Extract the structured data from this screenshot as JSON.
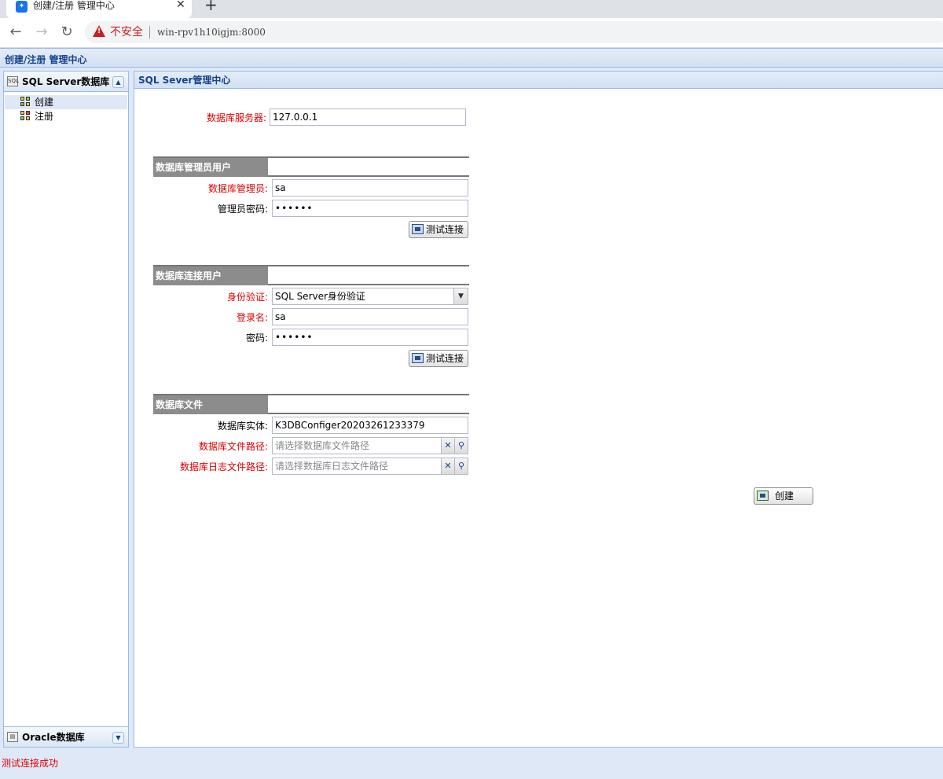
{
  "browser": {
    "tab_title": "创建/注册 管理中心",
    "insecure_label": "不安全",
    "url": "win-rpv1h10igjm:8000"
  },
  "app": {
    "header_title": "创建/注册 管理中心",
    "status_message": "测试连接成功"
  },
  "sidebar": {
    "sqlserver_title": "SQL Server数据库",
    "items": [
      {
        "label": "创建"
      },
      {
        "label": "注册"
      }
    ],
    "oracle_title": "Oracle数据库"
  },
  "main": {
    "title": "SQL Sever管理中心",
    "server_label": "数据库服务器:",
    "server_value": "127.0.0.1",
    "admin_section": {
      "title": "数据库管理员用户",
      "admin_label": "数据库管理员:",
      "admin_value": "sa",
      "password_label": "管理员密码:",
      "password_value": "••••••",
      "test_button": "测试连接"
    },
    "conn_section": {
      "title": "数据库连接用户",
      "auth_label": "身份验证:",
      "auth_value": "SQL Server身份验证",
      "login_label": "登录名:",
      "login_value": "sa",
      "password_label": "密码:",
      "password_value": "••••••",
      "test_button": "测试连接"
    },
    "file_section": {
      "title": "数据库文件",
      "entity_label": "数据库实体:",
      "entity_value": "K3DBConfiger20203261233379",
      "filepath_label": "数据库文件路径:",
      "filepath_placeholder": "请选择数据库文件路径",
      "logpath_label": "数据库日志文件路径:",
      "logpath_placeholder": "请选择数据库日志文件路径"
    },
    "create_button": "创建"
  },
  "colors": {
    "header_text": "#15428b",
    "panel_border": "#99bbe8",
    "required_label": "#e00000",
    "section_tab": "#8c8c8c"
  }
}
